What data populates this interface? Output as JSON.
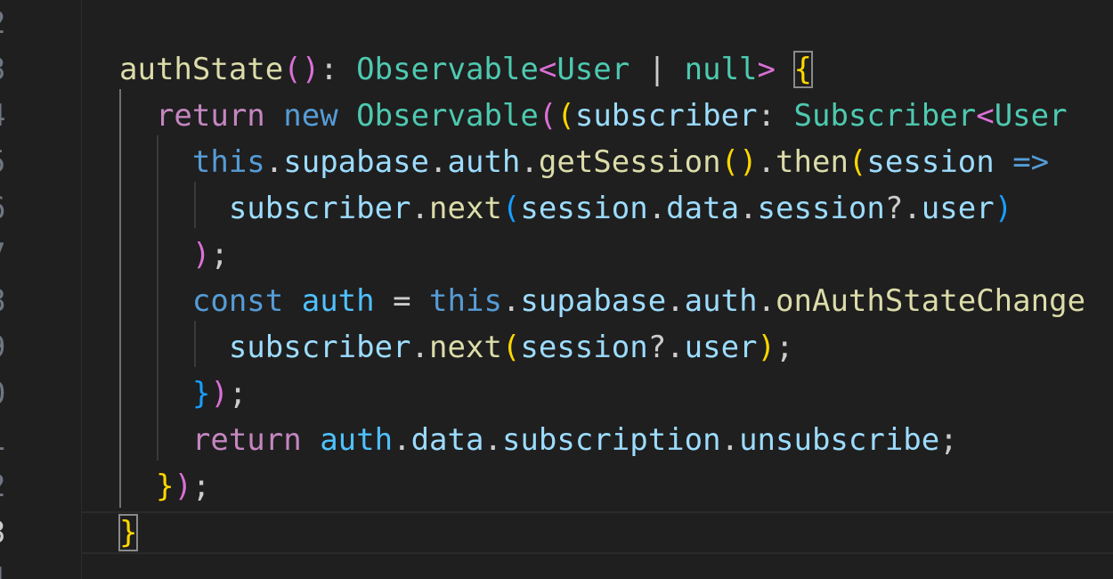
{
  "editor": {
    "line_numbers": [
      "2",
      "3",
      "4",
      "5",
      "6",
      "7",
      "8",
      "9",
      "0",
      "1",
      "2",
      "3",
      "4"
    ],
    "lines": [
      {
        "number": "2",
        "tokens": []
      },
      {
        "number": "3",
        "tokens": [
          {
            "text": "authState",
            "cls": "fn"
          },
          {
            "text": "()",
            "cls": "b2"
          },
          {
            "text": ": ",
            "cls": "pu"
          },
          {
            "text": "Observable",
            "cls": "ty"
          },
          {
            "text": "<",
            "cls": "b2"
          },
          {
            "text": "User",
            "cls": "ty"
          },
          {
            "text": " | ",
            "cls": "pu"
          },
          {
            "text": "null",
            "cls": "ty"
          },
          {
            "text": ">",
            "cls": "b2"
          },
          {
            "text": " ",
            "cls": "pu"
          },
          {
            "text": "{",
            "cls": "b1 match"
          }
        ]
      },
      {
        "number": "4",
        "tokens": [
          {
            "text": "  ",
            "cls": "pu"
          },
          {
            "text": "return",
            "cls": "ctl"
          },
          {
            "text": " ",
            "cls": "pu"
          },
          {
            "text": "new",
            "cls": "kw"
          },
          {
            "text": " ",
            "cls": "pu"
          },
          {
            "text": "Observable",
            "cls": "ty"
          },
          {
            "text": "(",
            "cls": "b2"
          },
          {
            "text": "(",
            "cls": "b1"
          },
          {
            "text": "subscriber",
            "cls": "vr"
          },
          {
            "text": ": ",
            "cls": "pu"
          },
          {
            "text": "Subscriber",
            "cls": "ty"
          },
          {
            "text": "<",
            "cls": "b2"
          },
          {
            "text": "User",
            "cls": "ty"
          }
        ]
      },
      {
        "number": "5",
        "tokens": [
          {
            "text": "    ",
            "cls": "pu"
          },
          {
            "text": "this",
            "cls": "kw"
          },
          {
            "text": ".",
            "cls": "pu"
          },
          {
            "text": "supabase",
            "cls": "vr"
          },
          {
            "text": ".",
            "cls": "pu"
          },
          {
            "text": "auth",
            "cls": "vr"
          },
          {
            "text": ".",
            "cls": "pu"
          },
          {
            "text": "getSession",
            "cls": "fn"
          },
          {
            "text": "()",
            "cls": "b1"
          },
          {
            "text": ".",
            "cls": "pu"
          },
          {
            "text": "then",
            "cls": "fn"
          },
          {
            "text": "(",
            "cls": "b1"
          },
          {
            "text": "session",
            "cls": "vr"
          },
          {
            "text": " ",
            "cls": "pu"
          },
          {
            "text": "=>",
            "cls": "kw"
          }
        ]
      },
      {
        "number": "6",
        "tokens": [
          {
            "text": "      ",
            "cls": "pu"
          },
          {
            "text": "subscriber",
            "cls": "vr"
          },
          {
            "text": ".",
            "cls": "pu"
          },
          {
            "text": "next",
            "cls": "fn"
          },
          {
            "text": "(",
            "cls": "b3"
          },
          {
            "text": "session",
            "cls": "vr"
          },
          {
            "text": ".",
            "cls": "pu"
          },
          {
            "text": "data",
            "cls": "vr"
          },
          {
            "text": ".",
            "cls": "pu"
          },
          {
            "text": "session",
            "cls": "vr"
          },
          {
            "text": "?.",
            "cls": "pu"
          },
          {
            "text": "user",
            "cls": "vr"
          },
          {
            "text": ")",
            "cls": "b3"
          }
        ]
      },
      {
        "number": "7",
        "tokens": [
          {
            "text": "    ",
            "cls": "pu"
          },
          {
            "text": ")",
            "cls": "b2"
          },
          {
            "text": ";",
            "cls": "pu"
          }
        ]
      },
      {
        "number": "8",
        "tokens": [
          {
            "text": "    ",
            "cls": "pu"
          },
          {
            "text": "const",
            "cls": "kw"
          },
          {
            "text": " ",
            "cls": "pu"
          },
          {
            "text": "auth",
            "cls": "cn"
          },
          {
            "text": " = ",
            "cls": "pu"
          },
          {
            "text": "this",
            "cls": "kw"
          },
          {
            "text": ".",
            "cls": "pu"
          },
          {
            "text": "supabase",
            "cls": "vr"
          },
          {
            "text": ".",
            "cls": "pu"
          },
          {
            "text": "auth",
            "cls": "vr"
          },
          {
            "text": ".",
            "cls": "pu"
          },
          {
            "text": "onAuthStateChange",
            "cls": "fn"
          }
        ]
      },
      {
        "number": "9",
        "tokens": [
          {
            "text": "      ",
            "cls": "pu"
          },
          {
            "text": "subscriber",
            "cls": "vr"
          },
          {
            "text": ".",
            "cls": "pu"
          },
          {
            "text": "next",
            "cls": "fn"
          },
          {
            "text": "(",
            "cls": "b1"
          },
          {
            "text": "session",
            "cls": "vr"
          },
          {
            "text": "?.",
            "cls": "pu"
          },
          {
            "text": "user",
            "cls": "vr"
          },
          {
            "text": ")",
            "cls": "b1"
          },
          {
            "text": ";",
            "cls": "pu"
          }
        ]
      },
      {
        "number": "0",
        "tokens": [
          {
            "text": "    ",
            "cls": "pu"
          },
          {
            "text": "}",
            "cls": "b3"
          },
          {
            "text": ")",
            "cls": "b2"
          },
          {
            "text": ";",
            "cls": "pu"
          }
        ]
      },
      {
        "number": "1",
        "tokens": [
          {
            "text": "    ",
            "cls": "pu"
          },
          {
            "text": "return",
            "cls": "ctl"
          },
          {
            "text": " ",
            "cls": "pu"
          },
          {
            "text": "auth",
            "cls": "cn"
          },
          {
            "text": ".",
            "cls": "pu"
          },
          {
            "text": "data",
            "cls": "vr"
          },
          {
            "text": ".",
            "cls": "pu"
          },
          {
            "text": "subscription",
            "cls": "vr"
          },
          {
            "text": ".",
            "cls": "pu"
          },
          {
            "text": "unsubscribe",
            "cls": "vr"
          },
          {
            "text": ";",
            "cls": "pu"
          }
        ]
      },
      {
        "number": "2",
        "tokens": [
          {
            "text": "  ",
            "cls": "pu"
          },
          {
            "text": "}",
            "cls": "b1"
          },
          {
            "text": ")",
            "cls": "b2"
          },
          {
            "text": ";",
            "cls": "pu"
          }
        ]
      },
      {
        "number": "3",
        "active": true,
        "tokens": [
          {
            "text": "}",
            "cls": "b1 match"
          }
        ]
      },
      {
        "number": "4",
        "tokens": []
      }
    ]
  },
  "theme": {
    "background": "#1f1f1f",
    "keyword": "#569cd6",
    "control": "#c586c0",
    "function": "#dcdcaa",
    "type": "#4ec9b0",
    "variable": "#9cdcfe",
    "constant": "#4fc1ff",
    "bracket_1": "#ffd700",
    "bracket_2": "#da70d6",
    "bracket_3": "#179fff"
  }
}
